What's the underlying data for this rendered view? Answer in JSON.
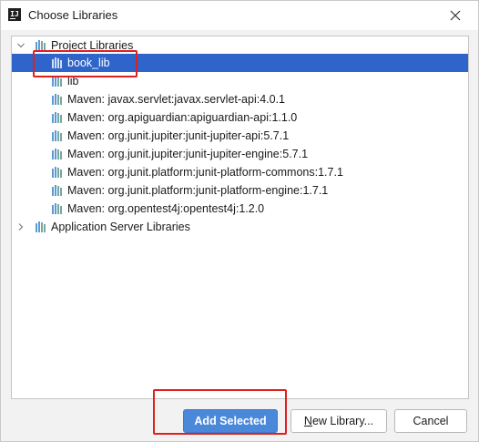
{
  "window": {
    "title": "Choose Libraries",
    "app_icon_text": "IJ"
  },
  "tree": {
    "project_group": {
      "label": "Project Libraries",
      "expanded": true,
      "items": [
        {
          "label": "book_lib",
          "selected": true
        },
        {
          "label": "lib",
          "selected": false
        },
        {
          "label": "Maven: javax.servlet:javax.servlet-api:4.0.1",
          "selected": false
        },
        {
          "label": "Maven: org.apiguardian:apiguardian-api:1.1.0",
          "selected": false
        },
        {
          "label": "Maven: org.junit.jupiter:junit-jupiter-api:5.7.1",
          "selected": false
        },
        {
          "label": "Maven: org.junit.jupiter:junit-jupiter-engine:5.7.1",
          "selected": false
        },
        {
          "label": "Maven: org.junit.platform:junit-platform-commons:1.7.1",
          "selected": false
        },
        {
          "label": "Maven: org.junit.platform:junit-platform-engine:1.7.1",
          "selected": false
        },
        {
          "label": "Maven: org.opentest4j:opentest4j:1.2.0",
          "selected": false
        }
      ]
    },
    "server_group": {
      "label": "Application Server Libraries",
      "expanded": false
    }
  },
  "buttons": {
    "add_selected": "Add Selected",
    "new_library_mnemonic": "N",
    "new_library_rest": "ew Library...",
    "cancel": "Cancel"
  },
  "colors": {
    "selection": "#2f65ca",
    "primary_button": "#4a88d9",
    "highlight_box": "#e02020",
    "library_icon": "#5a9bd5"
  },
  "icons": {
    "app": "intellij-icon",
    "close": "close-icon",
    "expand": "chevron-down-icon",
    "collapse": "chevron-right-icon",
    "library": "library-icon"
  }
}
